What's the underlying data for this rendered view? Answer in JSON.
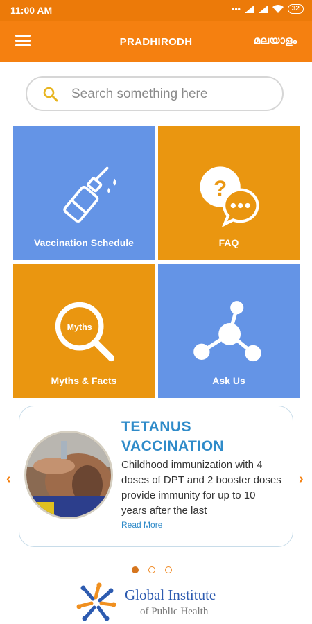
{
  "status_bar": {
    "time": "11:00 AM",
    "battery": "32"
  },
  "app_bar": {
    "title": "PRADHIRODH",
    "language": "മലയാളം"
  },
  "search": {
    "placeholder": "Search something here"
  },
  "tiles": [
    {
      "label": "Vaccination Schedule",
      "icon": "vaccine-bottle-icon",
      "color": "#6494e6"
    },
    {
      "label": "FAQ",
      "icon": "faq-chat-icon",
      "color": "#ea9610"
    },
    {
      "label": "Myths & Facts",
      "icon": "magnifier-icon",
      "icon_text": "Myths",
      "color": "#ea9610"
    },
    {
      "label": "Ask Us",
      "icon": "network-icon",
      "color": "#6494e6"
    }
  ],
  "carousel": {
    "title_line1": "TETANUS",
    "title_line2": "VACCINATION",
    "text": "Childhood immunization with 4 doses of  DPT and 2 booster doses provide immunity for up to 10 years after the last",
    "read_more": "Read More",
    "prev_icon": "‹",
    "next_icon": "›",
    "active_index": 0,
    "count": 3
  },
  "footer": {
    "org_line1": "Global Institute",
    "org_line2": "of Public Health"
  },
  "colors": {
    "primary": "#f58010",
    "accent_blue": "#2f8bc9"
  }
}
